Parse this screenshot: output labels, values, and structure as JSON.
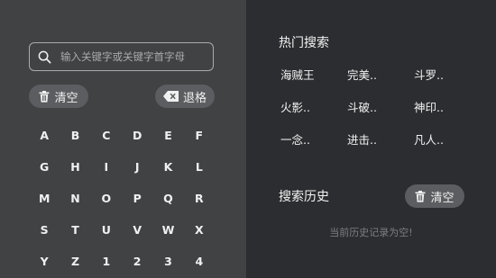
{
  "search": {
    "placeholder": "输入关键字或关键字首字母",
    "value": ""
  },
  "buttons": {
    "clear_label": "清空",
    "backspace_label": "退格",
    "history_clear_label": "清空"
  },
  "keyboard": {
    "keys": [
      "A",
      "B",
      "C",
      "D",
      "E",
      "F",
      "G",
      "H",
      "I",
      "J",
      "K",
      "L",
      "M",
      "N",
      "O",
      "P",
      "Q",
      "R",
      "S",
      "T",
      "U",
      "V",
      "W",
      "X",
      "Y",
      "Z",
      "1",
      "2",
      "3",
      "4"
    ]
  },
  "hot_search": {
    "title": "热门搜索",
    "items": [
      "海贼王",
      "完美..",
      "斗罗..",
      "火影..",
      "斗破..",
      "神印..",
      "一念..",
      "进击..",
      "凡人.."
    ]
  },
  "history": {
    "title": "搜索历史",
    "empty_text": "当前历史记录为空!"
  },
  "colors": {
    "left_panel": "#404244",
    "right_panel": "#2b2d30",
    "pill": "#5b5d60"
  }
}
